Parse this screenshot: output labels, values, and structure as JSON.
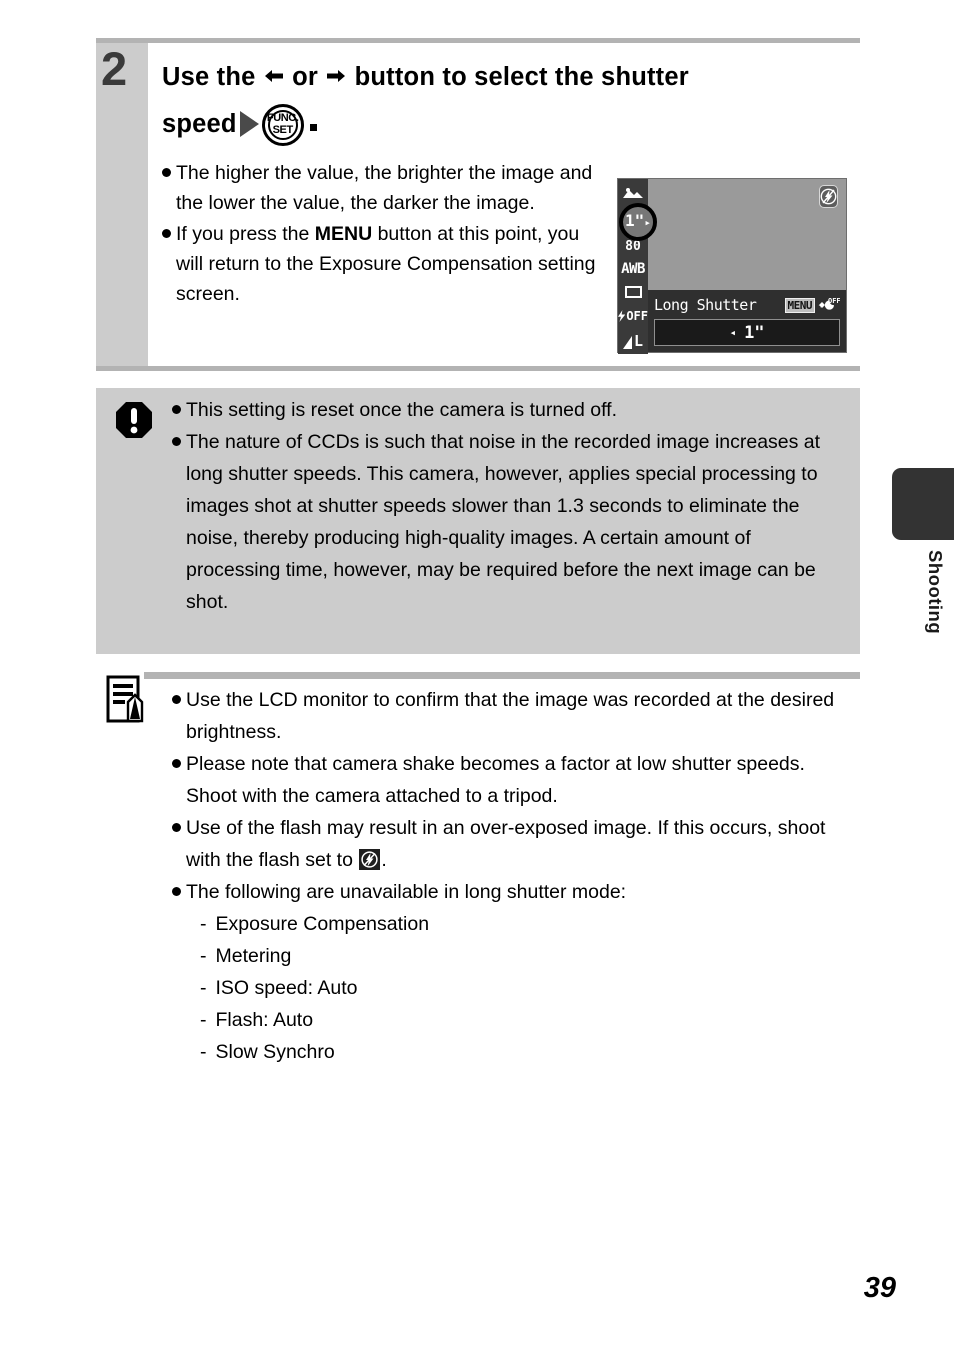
{
  "page": {
    "number": "39",
    "side_tab_label": "Shooting"
  },
  "step": {
    "number": "2",
    "heading_part1": "Use the",
    "heading_or": "or",
    "heading_part2": "button to select the shutter",
    "heading_part3": "speed",
    "funcset_line1": "FUNC.",
    "funcset_line2": "SET",
    "bullets": [
      "The higher the value, the brighter the image and the lower the value, the darker the image.",
      "If you press the MENU button at this point, you will return to the Exposure Compensation setting screen."
    ],
    "bullet2_prefix": "If you press the ",
    "bullet2_bold": "MENU",
    "bullet2_suffix": " button at this point, you will return to the Exposure Compensation setting screen."
  },
  "lcd": {
    "sidebar": {
      "drive": "",
      "shutter_speed": "1\"",
      "iso": "80",
      "white_balance": "AWB",
      "metering": "",
      "flash": "OFF",
      "quality": "L"
    },
    "title": "Long Shutter",
    "menu_badge": "MENU",
    "off_label": "OFF",
    "value": "1\"",
    "value_arrow": "◂",
    "selector_arrow": "▸"
  },
  "caution": {
    "bullets": [
      "This setting is reset once the camera is turned off.",
      "The nature of CCDs is such that noise in the recorded image increases at long shutter speeds. This camera, however, applies special processing to images shot at shutter speeds slower than 1.3 seconds to eliminate the noise, thereby producing high-quality images. A certain amount of processing time, however, may be required before the next image can be shot."
    ]
  },
  "note": {
    "bullets": [
      "Use the LCD monitor to confirm that the image was recorded at the desired brightness.",
      "Please note that camera shake becomes a factor at low shutter speeds. Shoot with the camera attached to a tripod.",
      "Use of the flash may result in an over-exposed image. If this occurs, shoot with the flash set to",
      "The following are unavailable in long shutter mode:"
    ],
    "flash_bullet_suffix": ".",
    "unavailable_items": [
      "Exposure Compensation",
      "Metering",
      "ISO speed: Auto",
      "Flash: Auto",
      "Slow Synchro"
    ],
    "dash": "-"
  }
}
